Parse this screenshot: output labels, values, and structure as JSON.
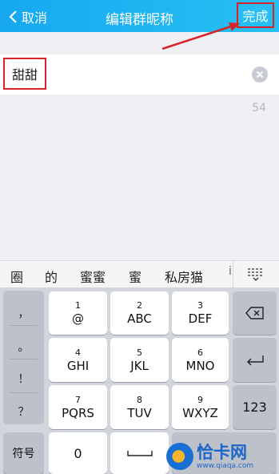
{
  "header": {
    "back_label": "取消",
    "title": "编辑群昵称",
    "done_label": "完成"
  },
  "input": {
    "value": "甜甜",
    "char_count": "54"
  },
  "candidates": {
    "items": [
      "圈",
      "的",
      "蜜蜜",
      "蜜",
      "私房猫"
    ],
    "more": "i"
  },
  "keyboard": {
    "punctuation": [
      "，",
      "。",
      "！",
      "？"
    ],
    "keys": [
      {
        "num": "1",
        "letters": "@"
      },
      {
        "num": "2",
        "letters": "ABC"
      },
      {
        "num": "3",
        "letters": "DEF"
      },
      {
        "num": "4",
        "letters": "GHI"
      },
      {
        "num": "5",
        "letters": "JKL"
      },
      {
        "num": "6",
        "letters": "MNO"
      },
      {
        "num": "7",
        "letters": "PQRS"
      },
      {
        "num": "8",
        "letters": "TUV"
      },
      {
        "num": "9",
        "letters": "WXYZ"
      }
    ],
    "num_mode_label": "123",
    "symbols_label": "符号",
    "zero_label": "0"
  },
  "watermark": {
    "main": "恰卡网",
    "sub": "www.qiaqa.com"
  },
  "colors": {
    "header_start": "#16a8f0",
    "header_end": "#27c0f3",
    "annotation": "#d9222a",
    "keyboard_bg": "#d2d5db"
  }
}
